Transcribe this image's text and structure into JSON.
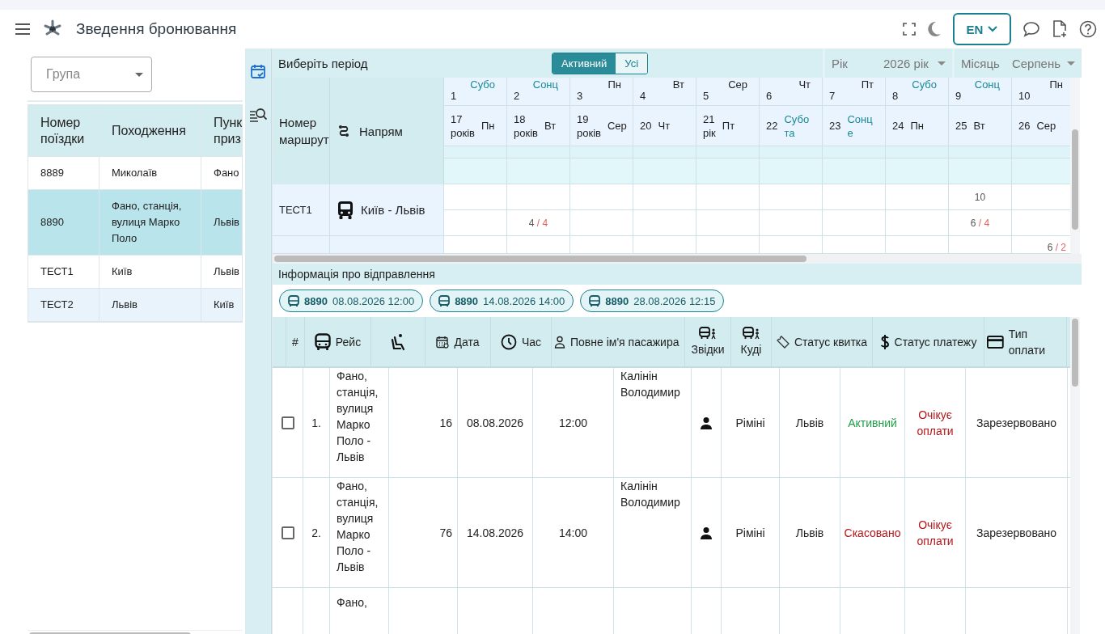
{
  "header": {
    "title": "Зведення бронювання",
    "language": "EN"
  },
  "left": {
    "group_select": {
      "placeholder": "Група"
    },
    "columns": [
      "Номер поїздки",
      "Походження",
      "Пунк приз"
    ],
    "rows": [
      {
        "cells": [
          "8889",
          "Миколаїв",
          "Фано"
        ],
        "selected": false
      },
      {
        "cells": [
          "8890",
          "Фано, станція, вулиця Марко Поло",
          "Львів"
        ],
        "selected": true
      },
      {
        "cells": [
          "ТЕСТ1",
          "Київ",
          "Львів"
        ],
        "selected": false
      },
      {
        "cells": [
          "ТЕСТ2",
          "Львів",
          "Київ"
        ],
        "selected": false
      }
    ]
  },
  "calendar": {
    "title": "Виберіть період",
    "filter": [
      {
        "label": "Активний",
        "selected": true
      },
      {
        "label": "Усі",
        "selected": false
      }
    ],
    "year": {
      "label": "Рік",
      "value": "2026 рік"
    },
    "month": {
      "label": "Місяць",
      "value": "Серпень"
    },
    "route_header": "Номер маршрут",
    "direction_header": "Напрям",
    "days_top": [
      {
        "num": "1",
        "weekday": "Субо",
        "weekend": true
      },
      {
        "num": "2",
        "weekday": "Сонц",
        "weekend": true
      },
      {
        "num": "3",
        "weekday": "Пн",
        "weekend": false
      },
      {
        "num": "4",
        "weekday": "Вт",
        "weekend": false
      },
      {
        "num": "5",
        "weekday": "Сер",
        "weekend": false
      },
      {
        "num": "6",
        "weekday": "Чт",
        "weekend": false
      },
      {
        "num": "7",
        "weekday": "Пт",
        "weekend": false
      },
      {
        "num": "8",
        "weekday": "Субо",
        "weekend": true
      },
      {
        "num": "9",
        "weekday": "Сонц",
        "weekend": true
      },
      {
        "num": "10",
        "weekday": "Пн",
        "weekend": false
      }
    ],
    "days_bottom": [
      {
        "num": "17\nроків",
        "weekday": "Пн",
        "weekend": false
      },
      {
        "num": "18\nроків",
        "weekday": "Вт",
        "weekend": false
      },
      {
        "num": "19\nроків",
        "weekday": "Сер",
        "weekend": false
      },
      {
        "num": "20",
        "weekday": "Чт",
        "weekend": false
      },
      {
        "num": "21\nрік",
        "weekday": "Пт",
        "weekend": false
      },
      {
        "num": "22",
        "weekday": "Субо\nта",
        "weekend": true
      },
      {
        "num": "23",
        "weekday": "Сонц\nе",
        "weekend": true
      },
      {
        "num": "24",
        "weekday": "Пн",
        "weekend": false
      },
      {
        "num": "25",
        "weekday": "Вт",
        "weekend": false
      },
      {
        "num": "26",
        "weekday": "Сер",
        "weekend": false
      }
    ],
    "rows": [
      {
        "route": "ТЕСТ1",
        "direction": "Київ - Львів",
        "lines": [
          [
            {
              "kind": "empty"
            },
            {
              "kind": "empty"
            },
            {
              "kind": "empty"
            },
            {
              "kind": "empty"
            },
            {
              "kind": "empty"
            },
            {
              "kind": "empty"
            },
            {
              "kind": "empty"
            },
            {
              "kind": "empty"
            },
            {
              "kind": "count",
              "value": "10"
            },
            {
              "kind": "empty"
            }
          ],
          [
            {
              "kind": "empty"
            },
            {
              "kind": "ratio",
              "free": "4",
              "separator": "/",
              "booked": "4"
            },
            {
              "kind": "empty"
            },
            {
              "kind": "empty"
            },
            {
              "kind": "empty"
            },
            {
              "kind": "empty"
            },
            {
              "kind": "empty"
            },
            {
              "kind": "empty"
            },
            {
              "kind": "ratio",
              "free": "6",
              "separator": "/",
              "booked": "4"
            },
            {
              "kind": "empty"
            }
          ]
        ]
      }
    ],
    "partial_row": [
      {
        "kind": "empty"
      },
      {
        "kind": "empty"
      },
      {
        "kind": "empty"
      },
      {
        "kind": "empty"
      },
      {
        "kind": "empty"
      },
      {
        "kind": "empty"
      },
      {
        "kind": "empty"
      },
      {
        "kind": "empty"
      },
      {
        "kind": "empty"
      },
      {
        "kind": "ratio",
        "free": "6",
        "separator": "/",
        "booked": "2"
      }
    ]
  },
  "departures": {
    "title": "Інформація про відправлення",
    "trips": [
      {
        "number": "8890",
        "datetime": "08.08.2026 12:00"
      },
      {
        "number": "8890",
        "datetime": "14.08.2026 14:00"
      },
      {
        "number": "8890",
        "datetime": "28.08.2026 12:15"
      }
    ],
    "columns": [
      {
        "kind": "check"
      },
      {
        "kind": "text",
        "label": "#"
      },
      {
        "kind": "bus",
        "label": "Рейс"
      },
      {
        "kind": "seat"
      },
      {
        "kind": "calendar",
        "label": "Дата"
      },
      {
        "kind": "clock",
        "label": "Час"
      },
      {
        "kind": "person",
        "label": "Повне ім'я пасажира"
      },
      {
        "kind": "busfrom",
        "label": "Звідки"
      },
      {
        "kind": "busto",
        "label": "Куді"
      },
      {
        "kind": "ticket",
        "label": "Статус квитка"
      },
      {
        "kind": "dollar",
        "label": "Статус платежу"
      },
      {
        "kind": "card",
        "label": "Тип оплати"
      }
    ],
    "rows": [
      {
        "checked": false,
        "index": "1.",
        "route": "Фано, станція, вулиця Марко Поло - Львів",
        "seat": "16",
        "date": "08.08.2026",
        "time": "12:00",
        "passenger": "Калінін Володимир",
        "from": "Ріміні",
        "to": "Львів",
        "ticket_status": {
          "text": "Активний",
          "color": "#1f9e4a"
        },
        "payment_status": "Очікує оплати",
        "payment_type": "Зарезервовано"
      },
      {
        "checked": false,
        "index": "2.",
        "route": "Фано, станція, вулиця Марко Поло - Львів",
        "seat": "76",
        "date": "14.08.2026",
        "time": "14:00",
        "passenger": "Калінін Володимир",
        "from": "Ріміні",
        "to": "Львів",
        "ticket_status": {
          "text": "Скасовано",
          "color": "#b3161a"
        },
        "payment_status": "Очікує оплати",
        "payment_type": "Зарезервовано"
      }
    ],
    "partial_row": {
      "route": "Фано,"
    }
  }
}
